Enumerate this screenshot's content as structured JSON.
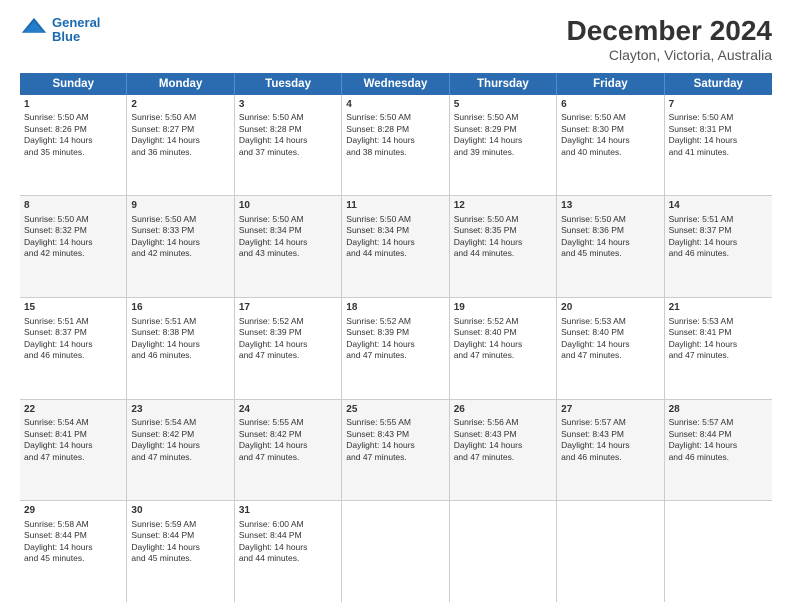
{
  "logo": {
    "line1": "General",
    "line2": "Blue"
  },
  "title": "December 2024",
  "subtitle": "Clayton, Victoria, Australia",
  "header_days": [
    "Sunday",
    "Monday",
    "Tuesday",
    "Wednesday",
    "Thursday",
    "Friday",
    "Saturday"
  ],
  "weeks": [
    [
      {
        "day": 1,
        "lines": [
          "Sunrise: 5:50 AM",
          "Sunset: 8:26 PM",
          "Daylight: 14 hours",
          "and 35 minutes."
        ]
      },
      {
        "day": 2,
        "lines": [
          "Sunrise: 5:50 AM",
          "Sunset: 8:27 PM",
          "Daylight: 14 hours",
          "and 36 minutes."
        ]
      },
      {
        "day": 3,
        "lines": [
          "Sunrise: 5:50 AM",
          "Sunset: 8:28 PM",
          "Daylight: 14 hours",
          "and 37 minutes."
        ]
      },
      {
        "day": 4,
        "lines": [
          "Sunrise: 5:50 AM",
          "Sunset: 8:28 PM",
          "Daylight: 14 hours",
          "and 38 minutes."
        ]
      },
      {
        "day": 5,
        "lines": [
          "Sunrise: 5:50 AM",
          "Sunset: 8:29 PM",
          "Daylight: 14 hours",
          "and 39 minutes."
        ]
      },
      {
        "day": 6,
        "lines": [
          "Sunrise: 5:50 AM",
          "Sunset: 8:30 PM",
          "Daylight: 14 hours",
          "and 40 minutes."
        ]
      },
      {
        "day": 7,
        "lines": [
          "Sunrise: 5:50 AM",
          "Sunset: 8:31 PM",
          "Daylight: 14 hours",
          "and 41 minutes."
        ]
      }
    ],
    [
      {
        "day": 8,
        "lines": [
          "Sunrise: 5:50 AM",
          "Sunset: 8:32 PM",
          "Daylight: 14 hours",
          "and 42 minutes."
        ]
      },
      {
        "day": 9,
        "lines": [
          "Sunrise: 5:50 AM",
          "Sunset: 8:33 PM",
          "Daylight: 14 hours",
          "and 42 minutes."
        ]
      },
      {
        "day": 10,
        "lines": [
          "Sunrise: 5:50 AM",
          "Sunset: 8:34 PM",
          "Daylight: 14 hours",
          "and 43 minutes."
        ]
      },
      {
        "day": 11,
        "lines": [
          "Sunrise: 5:50 AM",
          "Sunset: 8:34 PM",
          "Daylight: 14 hours",
          "and 44 minutes."
        ]
      },
      {
        "day": 12,
        "lines": [
          "Sunrise: 5:50 AM",
          "Sunset: 8:35 PM",
          "Daylight: 14 hours",
          "and 44 minutes."
        ]
      },
      {
        "day": 13,
        "lines": [
          "Sunrise: 5:50 AM",
          "Sunset: 8:36 PM",
          "Daylight: 14 hours",
          "and 45 minutes."
        ]
      },
      {
        "day": 14,
        "lines": [
          "Sunrise: 5:51 AM",
          "Sunset: 8:37 PM",
          "Daylight: 14 hours",
          "and 46 minutes."
        ]
      }
    ],
    [
      {
        "day": 15,
        "lines": [
          "Sunrise: 5:51 AM",
          "Sunset: 8:37 PM",
          "Daylight: 14 hours",
          "and 46 minutes."
        ]
      },
      {
        "day": 16,
        "lines": [
          "Sunrise: 5:51 AM",
          "Sunset: 8:38 PM",
          "Daylight: 14 hours",
          "and 46 minutes."
        ]
      },
      {
        "day": 17,
        "lines": [
          "Sunrise: 5:52 AM",
          "Sunset: 8:39 PM",
          "Daylight: 14 hours",
          "and 47 minutes."
        ]
      },
      {
        "day": 18,
        "lines": [
          "Sunrise: 5:52 AM",
          "Sunset: 8:39 PM",
          "Daylight: 14 hours",
          "and 47 minutes."
        ]
      },
      {
        "day": 19,
        "lines": [
          "Sunrise: 5:52 AM",
          "Sunset: 8:40 PM",
          "Daylight: 14 hours",
          "and 47 minutes."
        ]
      },
      {
        "day": 20,
        "lines": [
          "Sunrise: 5:53 AM",
          "Sunset: 8:40 PM",
          "Daylight: 14 hours",
          "and 47 minutes."
        ]
      },
      {
        "day": 21,
        "lines": [
          "Sunrise: 5:53 AM",
          "Sunset: 8:41 PM",
          "Daylight: 14 hours",
          "and 47 minutes."
        ]
      }
    ],
    [
      {
        "day": 22,
        "lines": [
          "Sunrise: 5:54 AM",
          "Sunset: 8:41 PM",
          "Daylight: 14 hours",
          "and 47 minutes."
        ]
      },
      {
        "day": 23,
        "lines": [
          "Sunrise: 5:54 AM",
          "Sunset: 8:42 PM",
          "Daylight: 14 hours",
          "and 47 minutes."
        ]
      },
      {
        "day": 24,
        "lines": [
          "Sunrise: 5:55 AM",
          "Sunset: 8:42 PM",
          "Daylight: 14 hours",
          "and 47 minutes."
        ]
      },
      {
        "day": 25,
        "lines": [
          "Sunrise: 5:55 AM",
          "Sunset: 8:43 PM",
          "Daylight: 14 hours",
          "and 47 minutes."
        ]
      },
      {
        "day": 26,
        "lines": [
          "Sunrise: 5:56 AM",
          "Sunset: 8:43 PM",
          "Daylight: 14 hours",
          "and 47 minutes."
        ]
      },
      {
        "day": 27,
        "lines": [
          "Sunrise: 5:57 AM",
          "Sunset: 8:43 PM",
          "Daylight: 14 hours",
          "and 46 minutes."
        ]
      },
      {
        "day": 28,
        "lines": [
          "Sunrise: 5:57 AM",
          "Sunset: 8:44 PM",
          "Daylight: 14 hours",
          "and 46 minutes."
        ]
      }
    ],
    [
      {
        "day": 29,
        "lines": [
          "Sunrise: 5:58 AM",
          "Sunset: 8:44 PM",
          "Daylight: 14 hours",
          "and 45 minutes."
        ]
      },
      {
        "day": 30,
        "lines": [
          "Sunrise: 5:59 AM",
          "Sunset: 8:44 PM",
          "Daylight: 14 hours",
          "and 45 minutes."
        ]
      },
      {
        "day": 31,
        "lines": [
          "Sunrise: 6:00 AM",
          "Sunset: 8:44 PM",
          "Daylight: 14 hours",
          "and 44 minutes."
        ]
      },
      null,
      null,
      null,
      null
    ]
  ]
}
